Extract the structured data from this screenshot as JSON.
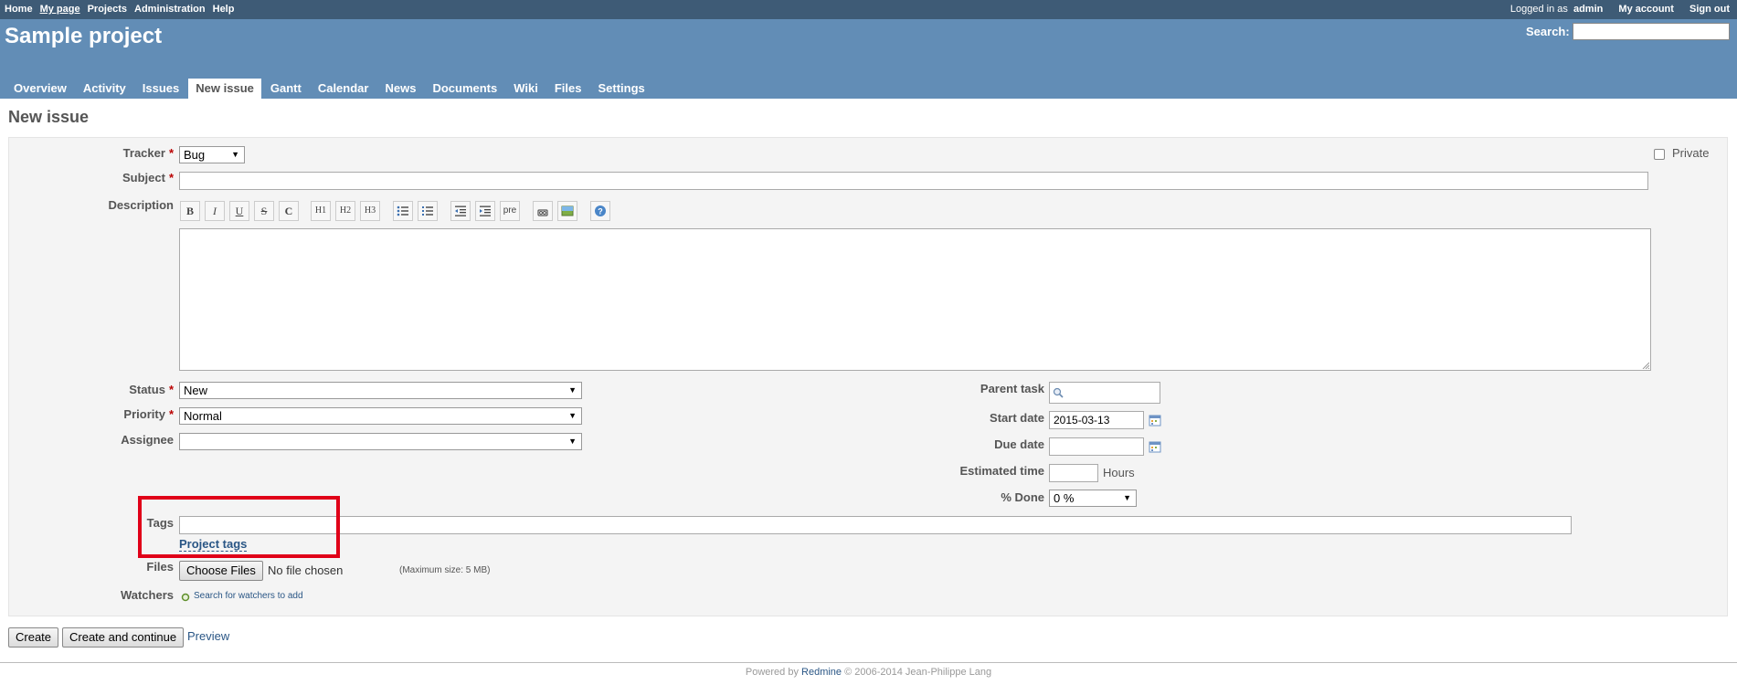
{
  "top_menu": {
    "items": [
      "Home",
      "My page",
      "Projects",
      "Administration",
      "Help"
    ],
    "logged_as_prefix": "Logged in as",
    "user": "admin",
    "my_account": "My account",
    "sign_out": "Sign out"
  },
  "header": {
    "project_title": "Sample project",
    "search_label": "Search:",
    "search_value": ""
  },
  "tabs": [
    "Overview",
    "Activity",
    "Issues",
    "New issue",
    "Gantt",
    "Calendar",
    "News",
    "Documents",
    "Wiki",
    "Files",
    "Settings"
  ],
  "selected_tab": "New issue",
  "page_title": "New issue",
  "form": {
    "tracker_label": "Tracker",
    "tracker_value": "Bug",
    "private_label": "Private",
    "subject_label": "Subject",
    "description_label": "Description",
    "toolbar": [
      "B",
      "I",
      "U",
      "S",
      "C",
      "H1",
      "H2",
      "H3",
      "ul",
      "ol",
      "indent-left",
      "indent-right",
      "pre",
      "link",
      "image",
      "help"
    ],
    "status_label": "Status",
    "status_value": "New",
    "priority_label": "Priority",
    "priority_value": "Normal",
    "assignee_label": "Assignee",
    "assignee_value": "",
    "parent_task_label": "Parent task",
    "start_date_label": "Start date",
    "start_date_value": "2015-03-13",
    "due_date_label": "Due date",
    "estimated_time_label": "Estimated time",
    "hours_label": "Hours",
    "done_label": "% Done",
    "done_value": "0 %",
    "tags_label": "Tags",
    "project_tags_link": "Project tags",
    "files_label": "Files",
    "choose_files": "Choose Files",
    "no_file": "No file chosen",
    "max_size": "(Maximum size: 5 MB)",
    "watchers_label": "Watchers",
    "watchers_link": "Search for watchers to add"
  },
  "buttons": {
    "create": "Create",
    "create_continue": "Create and continue",
    "preview": "Preview"
  },
  "footer": {
    "powered_by": "Powered by",
    "redmine": "Redmine",
    "copyright": "© 2006-2014 Jean-Philippe Lang"
  },
  "colors": {
    "top_menu_bg": "#3e5b76",
    "header_bg": "#628db6",
    "required_star": "#bb0000",
    "highlight_box": "#e00018",
    "link": "#2a5685"
  }
}
